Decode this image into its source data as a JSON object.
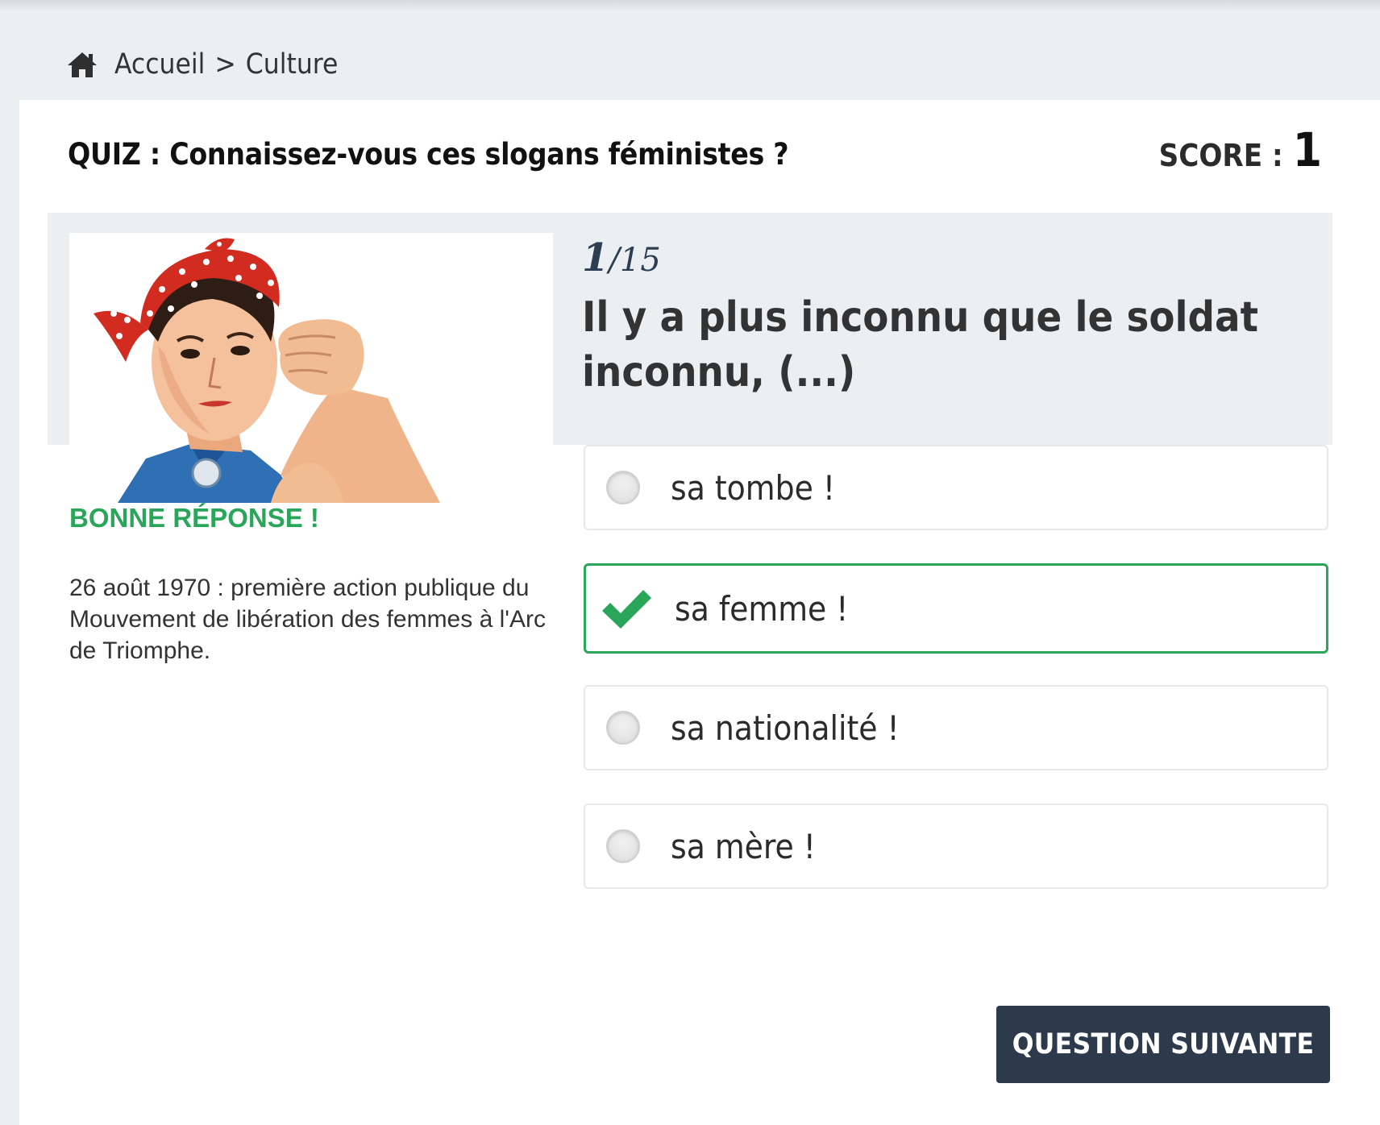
{
  "breadcrumb": {
    "home_label": "Accueil",
    "separator": ">",
    "current": "Culture"
  },
  "quiz": {
    "title": "QUIZ : Connaissez-vous ces slogans féministes ?",
    "score_label": "SCORE :",
    "score_value": "1"
  },
  "question": {
    "current": "1",
    "total": "/15",
    "text": "Il y a plus inconnu que le soldat inconnu, (...)",
    "image_icon": "rosie-the-riveter-illustration"
  },
  "feedback": {
    "status": "BONNE RÉPONSE !",
    "status_color": "#2aa65a",
    "explanation": "26 août 1970 : première action publique du Mouvement de libération des femmes à l'Arc de Triomphe."
  },
  "answers": [
    {
      "label": "sa tombe !",
      "state": "unselected"
    },
    {
      "label": "sa femme !",
      "state": "correct"
    },
    {
      "label": "sa nationalité !",
      "state": "unselected"
    },
    {
      "label": "sa mère !",
      "state": "unselected"
    }
  ],
  "actions": {
    "next_label": "QUESTION SUIVANTE"
  },
  "colors": {
    "accent_green": "#2aa65a",
    "button_dark": "#2c3a4b",
    "page_bg": "#eceff1"
  }
}
